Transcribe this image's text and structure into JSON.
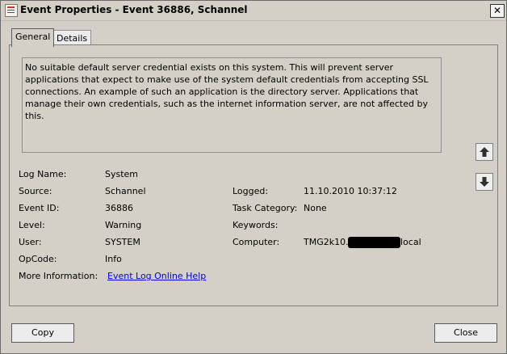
{
  "window": {
    "title": "Event Properties - Event 36886, Schannel"
  },
  "tabs": [
    {
      "label": "General"
    },
    {
      "label": "Details"
    }
  ],
  "description": "No suitable default server credential exists on this system. This will prevent server applications that expect to make use of the system default credentials from accepting SSL connections. An example of such an application is the directory server. Applications that manage their own credentials, such as the internet information server, are not affected by this.",
  "fields": {
    "log_name": {
      "label": "Log Name:",
      "value": "System"
    },
    "source": {
      "label": "Source:",
      "value": "Schannel"
    },
    "event_id": {
      "label": "Event ID:",
      "value": "36886"
    },
    "level": {
      "label": "Level:",
      "value": "Warning"
    },
    "user": {
      "label": "User:",
      "value": "SYSTEM"
    },
    "opcode": {
      "label": "OpCode:",
      "value": "Info"
    },
    "more_info": {
      "label": "More Information:",
      "value": "Event Log Online Help"
    },
    "logged": {
      "label": "Logged:",
      "value": "11.10.2010 10:37:12"
    },
    "task_category": {
      "label": "Task Category:",
      "value": "None"
    },
    "keywords": {
      "label": "Keywords:",
      "value": ""
    },
    "computer": {
      "label": "Computer:",
      "value_prefix": "TMG2k10.",
      "value_suffix": "local"
    }
  },
  "buttons": {
    "copy": "Copy",
    "close": "Close"
  },
  "icons": {
    "close": "✕",
    "up": "arrow-up-icon",
    "down": "arrow-down-icon"
  }
}
